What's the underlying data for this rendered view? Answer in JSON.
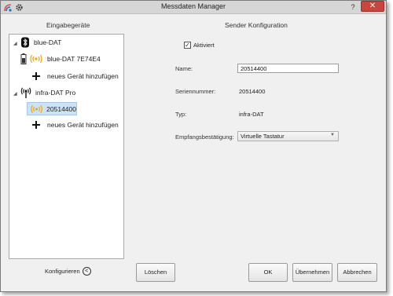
{
  "window": {
    "title": "Messdaten Manager",
    "help": "?",
    "close": "✕"
  },
  "left": {
    "heading": "Eingabegeräte",
    "tree": [
      {
        "label": "blue-DAT"
      },
      {
        "label": "blue-DAT 7E74E4"
      },
      {
        "label": "neues Gerät hinzufügen"
      },
      {
        "label": "infra-DAT Pro"
      },
      {
        "label": "20514400"
      },
      {
        "label": "neues Gerät hinzufügen"
      }
    ],
    "configure_label": "Konfigurieren"
  },
  "right": {
    "heading": "Sender Konfiguration",
    "activated_label": "Aktiviert",
    "activated_checked": true,
    "name_label": "Name:",
    "name_value": "20514400",
    "serial_label": "Seriennummer:",
    "serial_value": "20514400",
    "type_label": "Typ:",
    "type_value": "infra-DAT",
    "ack_label": "Empfangsbestätigung:",
    "ack_value": "Virtuelle Tastatur"
  },
  "buttons": {
    "delete": "Löschen",
    "ok": "OK",
    "apply": "Übernehmen",
    "cancel": "Abbrechen"
  },
  "colors": {
    "signal": "#f0a30a",
    "close_bg": "#c7463d",
    "selection": "#cde3f5"
  }
}
